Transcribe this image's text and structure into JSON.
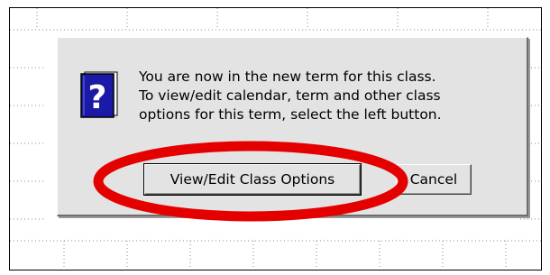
{
  "dialog": {
    "icon": "help-book-icon",
    "message_lines": [
      "You are now in the new term for this class.",
      "To view/edit calendar, term and other class",
      "options for this term, select the left button."
    ],
    "buttons": {
      "primary_label": "View/Edit Class Options",
      "cancel_label": "Cancel"
    }
  },
  "annotation": {
    "shape": "ellipse",
    "color": "#e50000"
  },
  "colors": {
    "dialog_face": "#e3e3e3",
    "icon_blue": "#1a1aa6",
    "grid_dots": "#8a8a8a"
  }
}
